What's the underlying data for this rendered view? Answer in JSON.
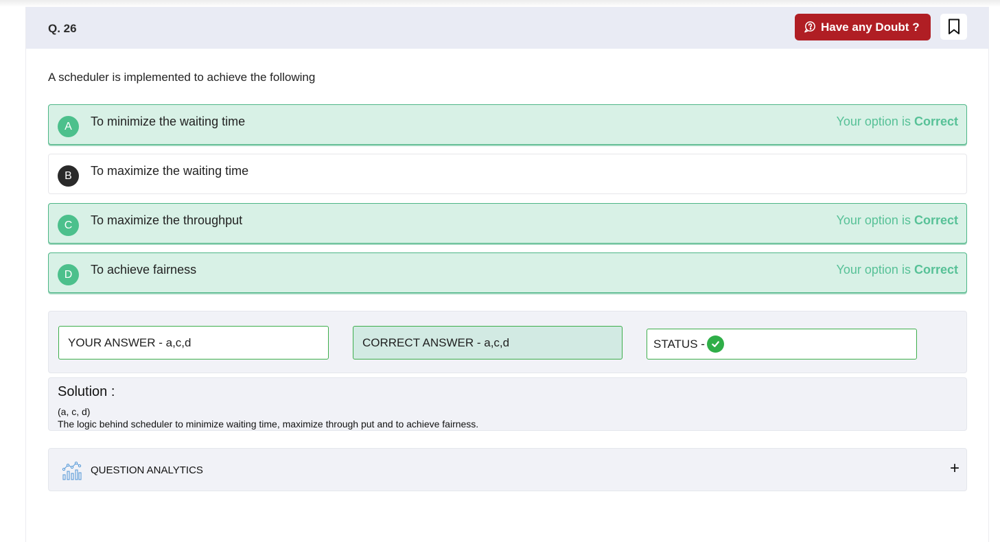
{
  "question": {
    "number_label": "Q. 26",
    "text": "A scheduler is implemented to achieve the following"
  },
  "header": {
    "doubt_button_label": "Have any Doubt ?",
    "doubt_button_color": "#b01e24",
    "doubt_icon": "doubt-bubble-icon",
    "bookmark_icon": "bookmark-icon"
  },
  "options": [
    {
      "letter": "A",
      "text": "To minimize the waiting time",
      "verdict_prefix": "Your option is",
      "verdict_word": "Correct",
      "state": "correct"
    },
    {
      "letter": "B",
      "text": "To maximize the waiting time",
      "state": "plain"
    },
    {
      "letter": "C",
      "text": "To maximize the throughput",
      "verdict_prefix": "Your option is",
      "verdict_word": "Correct",
      "state": "correct"
    },
    {
      "letter": "D",
      "text": "To achieve fairness",
      "verdict_prefix": "Your option is",
      "verdict_word": "Correct",
      "state": "correct"
    }
  ],
  "answers": {
    "your_answer": "YOUR ANSWER - a,c,d",
    "correct_answer": "CORRECT ANSWER - a,c,d",
    "status_label": "STATUS -",
    "status_icon": "check-circle-icon",
    "status_color": "#2fae48"
  },
  "solution": {
    "title": "Solution :",
    "line1": "(a, c, d)",
    "line2": "The logic behind scheduler to minimize waiting time, maximize through put and to achieve fairness."
  },
  "analytics": {
    "label": "QUESTION ANALYTICS",
    "expand_symbol": "+",
    "icon": "analytics-chart-icon"
  },
  "colors": {
    "correct_bg": "#d8f1e6",
    "correct_border": "#4bb585",
    "correct_text": "#57c197"
  }
}
